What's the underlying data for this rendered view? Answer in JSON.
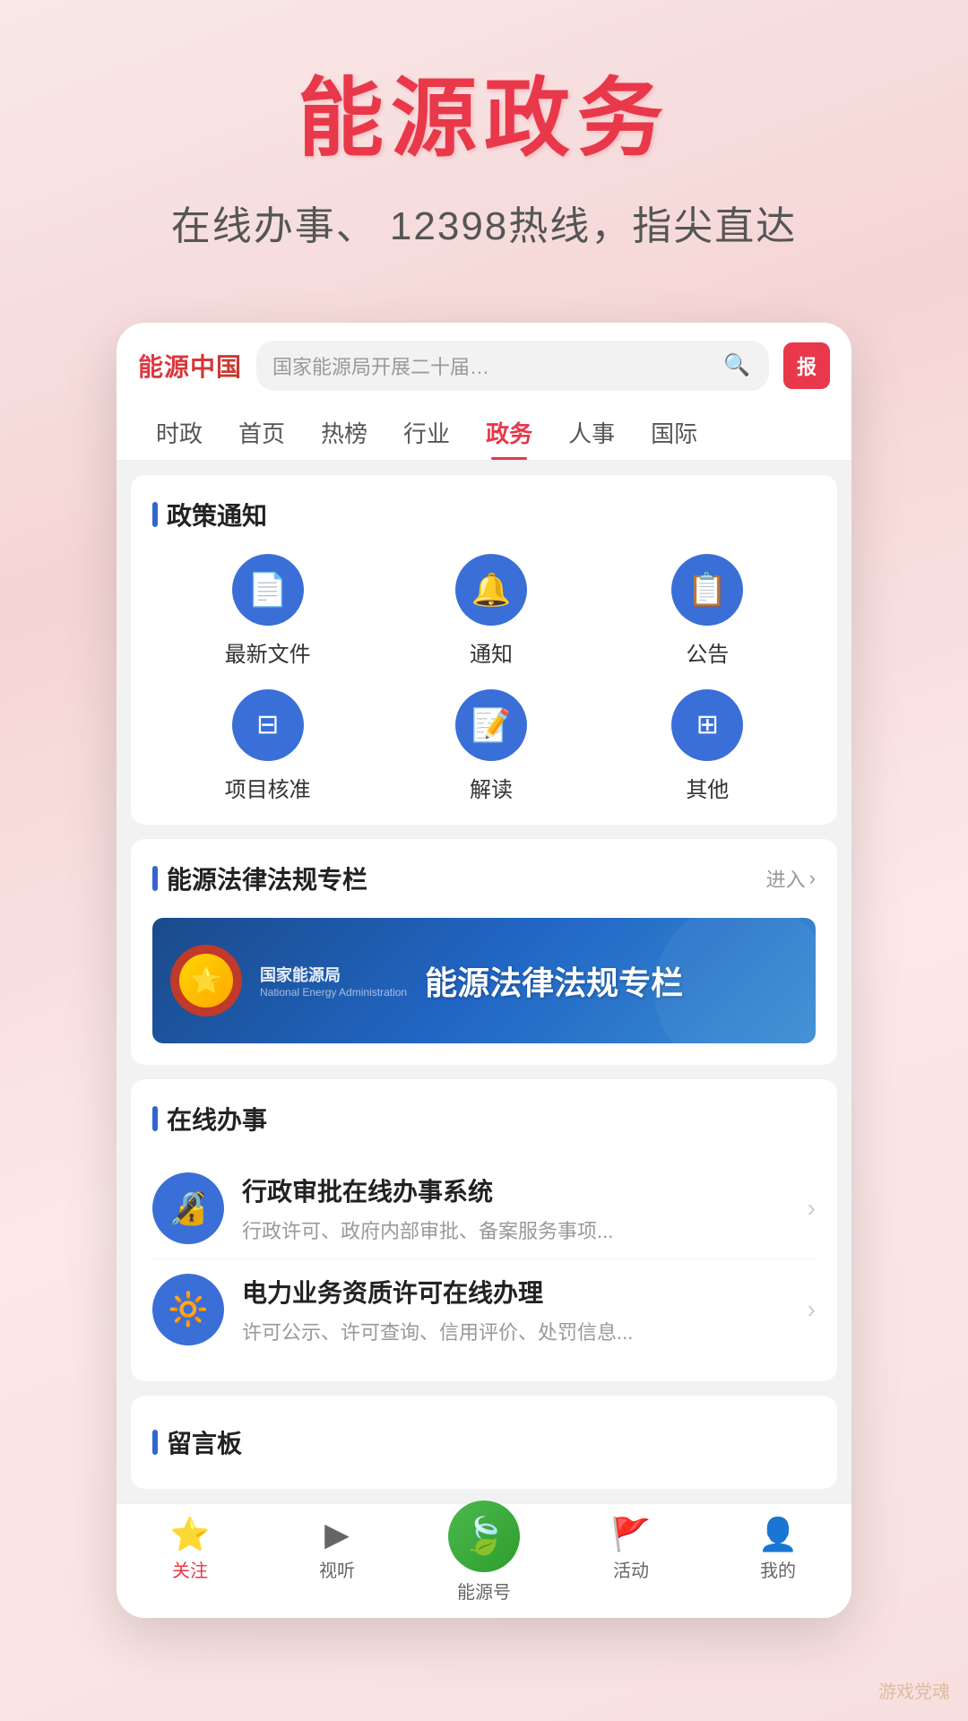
{
  "hero": {
    "title": "能源政务",
    "subtitle": "在线办事、 12398热线，指尖直达"
  },
  "app": {
    "logo": "能源中国",
    "search_placeholder": "国家能源局开展二十届…",
    "avatar_label": "报",
    "nav_tabs": [
      {
        "label": "时政",
        "active": false
      },
      {
        "label": "首页",
        "active": false
      },
      {
        "label": "热榜",
        "active": false
      },
      {
        "label": "行业",
        "active": false
      },
      {
        "label": "政务",
        "active": true
      },
      {
        "label": "人事",
        "active": false
      },
      {
        "label": "国际",
        "active": false
      }
    ]
  },
  "policy_section": {
    "title": "政策通知",
    "items_row1": [
      {
        "label": "最新文件",
        "icon": "📄"
      },
      {
        "label": "通知",
        "icon": "🔔"
      },
      {
        "label": "公告",
        "icon": "📋"
      }
    ],
    "items_row2": [
      {
        "label": "项目核准",
        "icon": "⊟"
      },
      {
        "label": "解读",
        "icon": "📝"
      },
      {
        "label": "其他",
        "icon": "⊞"
      }
    ]
  },
  "law_section": {
    "title": "能源法律法规专栏",
    "enter_label": "进入",
    "org_name": "国家能源局",
    "org_en": "National Energy Administration",
    "banner_title": "能源法律法规专栏"
  },
  "online_section": {
    "title": "在线办事",
    "items": [
      {
        "title": "行政审批在线办事系统",
        "desc": "行政许可、政府内部审批、备案服务事项..."
      },
      {
        "title": "电力业务资质许可在线办理",
        "desc": "许可公示、许可查询、信用评价、处罚信息..."
      }
    ]
  },
  "message_board": {
    "title": "留言板"
  },
  "bottom_nav": {
    "items": [
      {
        "label": "关注",
        "icon": "⭐",
        "active": true
      },
      {
        "label": "视听",
        "icon": "▶"
      },
      {
        "label": "能源号",
        "icon": "🍃",
        "is_center": true
      },
      {
        "label": "活动",
        "icon": "🚩"
      },
      {
        "label": "我的",
        "icon": "👤"
      }
    ]
  },
  "watermark": "游戏党魂"
}
